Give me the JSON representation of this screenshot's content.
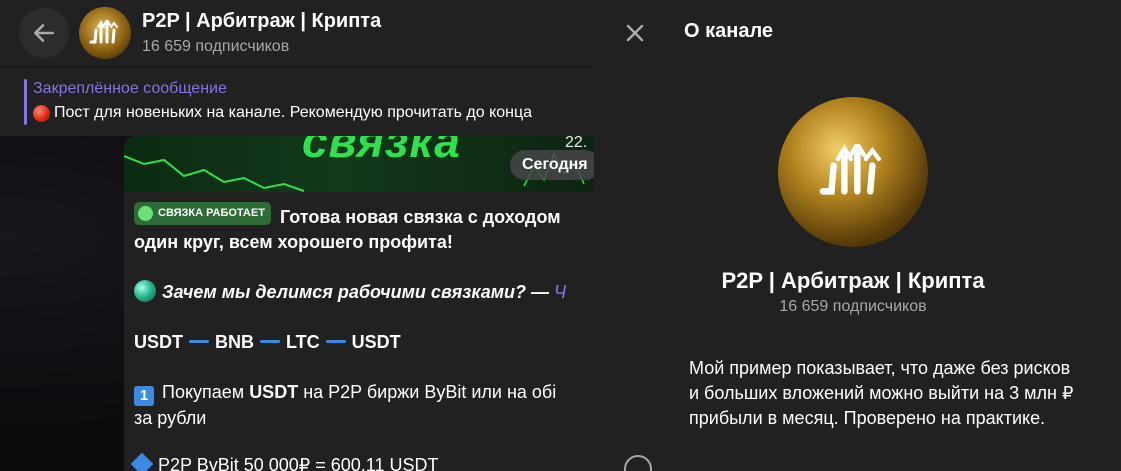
{
  "chat": {
    "back_icon": "arrow-left-icon",
    "channel_name": "P2P | Арбитраж | Крипта",
    "subscribers": "16 659 подписчиков",
    "pinned": {
      "title": "Закреплённое сообщение",
      "text": "Пост для новеньких на канале. Рекомендую прочитать до конца"
    },
    "post": {
      "image_word": "связка",
      "image_number": "22.",
      "date_pill": "Сегодня",
      "badge": "СВЯЗКА РАБОТАЕТ",
      "line1": "Готова новая связка с доходом",
      "line2": "один круг, всем хорошего профита!",
      "why_text": "Зачем мы делимся рабочими связками? —",
      "why_link": "Ч",
      "route": [
        "USDT",
        "BNB",
        "LTC",
        "USDT"
      ],
      "step1_num": "1",
      "step1_a": "Покупаем",
      "step1_b": "USDT",
      "step1_c": "на P2P биржи ByBit или на обі",
      "step1_d": "за рубли",
      "step2_partial": "P2P ByBit 50 000₽ = 600.11 USDT"
    }
  },
  "panel": {
    "close_icon": "close-icon",
    "title": "О канале",
    "channel_name": "P2P | Арбитраж | Крипта",
    "subscribers": "16 659 подписчиков",
    "description": "Мой пример показывает, что даже без рисков и больших вложений можно выйти на 3 млн ₽ прибыли в месяц. Проверено на практике.",
    "info_icon": "info-icon"
  },
  "colors": {
    "accent": "#8774e1",
    "panel_bg": "#212121",
    "green": "#2fe04f"
  }
}
